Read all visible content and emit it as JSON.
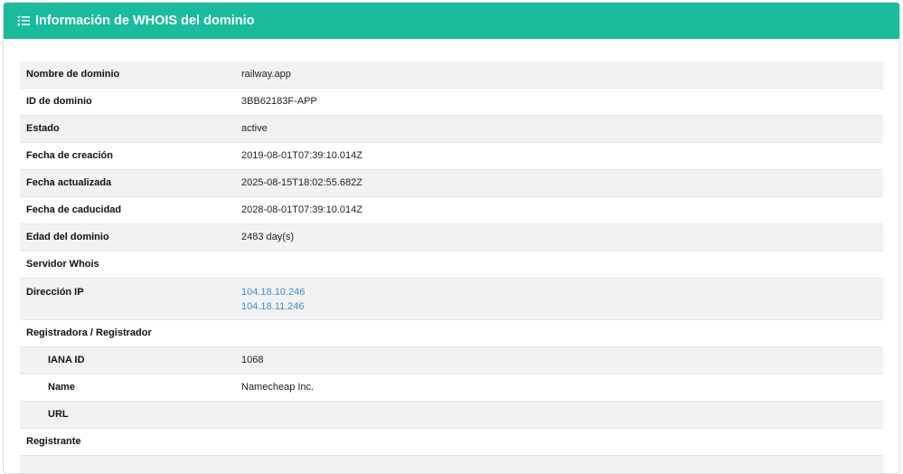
{
  "header": {
    "title": "Información de WHOIS del dominio",
    "icon": "list-check-icon"
  },
  "rows": {
    "domain_name": {
      "label": "Nombre de dominio",
      "value": "railway.app"
    },
    "domain_id": {
      "label": "ID de dominio",
      "value": "3BB62183F-APP"
    },
    "status": {
      "label": "Estado",
      "value": "active"
    },
    "created": {
      "label": "Fecha de creación",
      "value": "2019-08-01T07:39:10.014Z"
    },
    "updated": {
      "label": "Fecha actualizada",
      "value": "2025-08-15T18:02:55.682Z"
    },
    "expires": {
      "label": "Fecha de caducidad",
      "value": "2028-08-01T07:39:10.014Z"
    },
    "age": {
      "label": "Edad del dominio",
      "value": "2483 day(s)"
    },
    "whois_server": {
      "label": "Servidor Whois",
      "value": ""
    },
    "ip": {
      "label": "Dirección IP",
      "values": [
        "104.18.10.246",
        "104.18.11.246"
      ]
    },
    "registrar": {
      "label": "Registradora / Registrador",
      "iana_id": {
        "label": "IANA ID",
        "value": "1068"
      },
      "name": {
        "label": "Name",
        "value": "Namecheap Inc."
      },
      "url": {
        "label": "URL",
        "value": ""
      }
    },
    "registrant": {
      "label": "Registrante"
    }
  },
  "colors": {
    "header_bg": "#1abc9c",
    "stripe": "#f2f2f2",
    "link": "#3a8fd1"
  }
}
